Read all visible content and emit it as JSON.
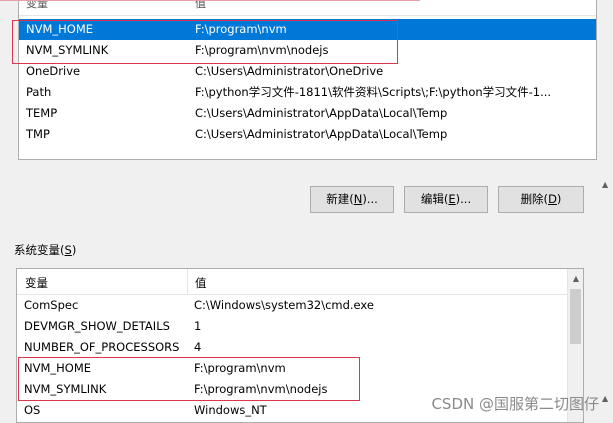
{
  "user_vars": {
    "header": {
      "name": "变量",
      "value": "值"
    },
    "rows": [
      {
        "name": "NVM_HOME",
        "value": "F:\\program\\nvm",
        "selected": true
      },
      {
        "name": "NVM_SYMLINK",
        "value": "F:\\program\\nvm\\nodejs",
        "selected": false
      },
      {
        "name": "OneDrive",
        "value": "C:\\Users\\Administrator\\OneDrive",
        "selected": false
      },
      {
        "name": "Path",
        "value": "F:\\python学习文件-1811\\软件资料\\Scripts\\;F:\\python学习文件-1...",
        "selected": false
      },
      {
        "name": "TEMP",
        "value": "C:\\Users\\Administrator\\AppData\\Local\\Temp",
        "selected": false
      },
      {
        "name": "TMP",
        "value": "C:\\Users\\Administrator\\AppData\\Local\\Temp",
        "selected": false
      }
    ],
    "buttons": {
      "new": {
        "text": "新建(",
        "key": "N",
        "suffix": ")..."
      },
      "edit": {
        "text": "编辑(",
        "key": "E",
        "suffix": ")..."
      },
      "delete": {
        "text": "删除(",
        "key": "D",
        "suffix": ")"
      }
    }
  },
  "system_vars": {
    "label": {
      "text": "系统变量(",
      "key": "S",
      "suffix": ")"
    },
    "header": {
      "name": "变量",
      "value": "值"
    },
    "rows": [
      {
        "name": "ComSpec",
        "value": "C:\\Windows\\system32\\cmd.exe"
      },
      {
        "name": "DEVMGR_SHOW_DETAILS",
        "value": "1"
      },
      {
        "name": "NUMBER_OF_PROCESSORS",
        "value": "4"
      },
      {
        "name": "NVM_HOME",
        "value": "F:\\program\\nvm"
      },
      {
        "name": "NVM_SYMLINK",
        "value": "F:\\program\\nvm\\nodejs"
      },
      {
        "name": "OS",
        "value": "Windows_NT"
      }
    ]
  },
  "icons": {
    "scroll_up": "scroll-up-arrow-icon"
  },
  "colors": {
    "selection": "#0078d7",
    "annotation": "#d9374b"
  },
  "watermark": "CSDN @国服第二切图仔"
}
